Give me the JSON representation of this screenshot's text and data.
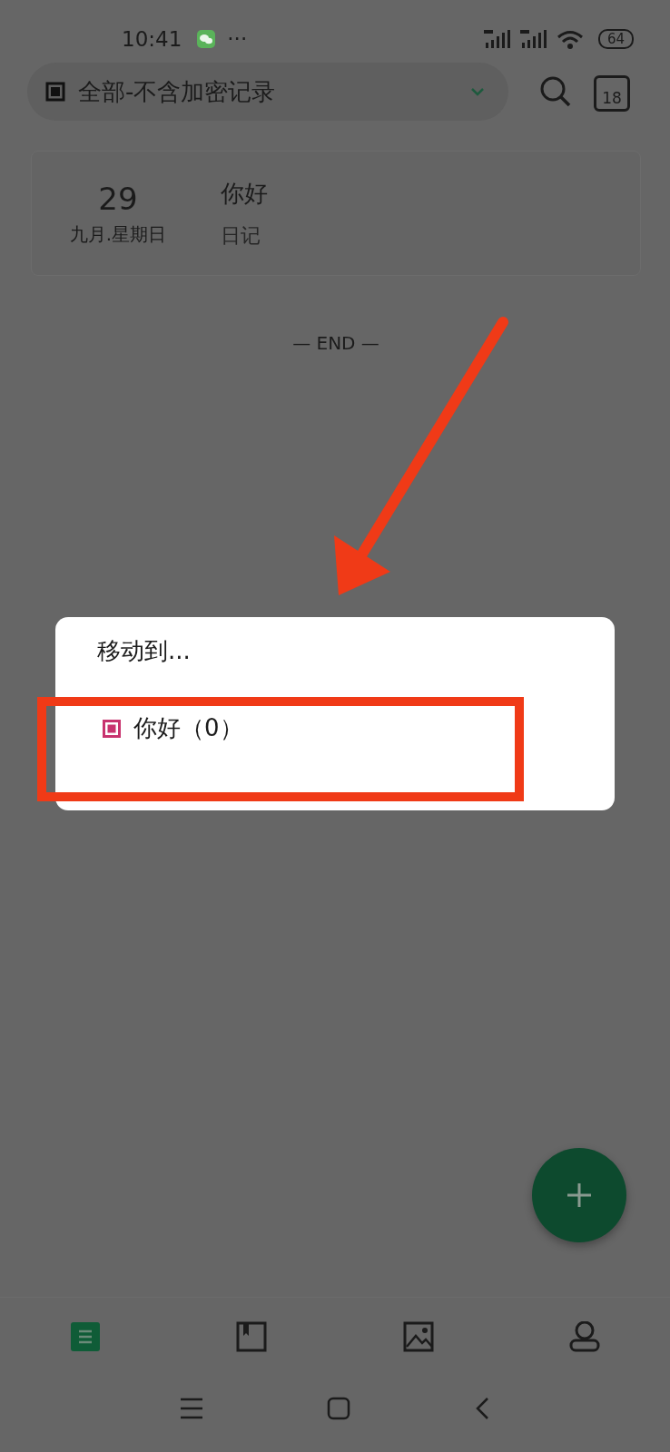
{
  "status_bar": {
    "time": "10:41",
    "more": "···",
    "battery": "64"
  },
  "header": {
    "filter_label": "全部-不含加密记录",
    "calendar_day": "18"
  },
  "entries": [
    {
      "day": "29",
      "date_label": "九月.星期日",
      "title": "你好",
      "category": "日记"
    }
  ],
  "end_label": "— END —",
  "dialog": {
    "title": "移动到...",
    "options": [
      {
        "label": "你好（0）",
        "color": "#c8336e"
      }
    ]
  },
  "bottom_nav": [
    {
      "kind": "list",
      "selected": true
    },
    {
      "kind": "book",
      "selected": false
    },
    {
      "kind": "image",
      "selected": false
    },
    {
      "kind": "person",
      "selected": false
    }
  ]
}
